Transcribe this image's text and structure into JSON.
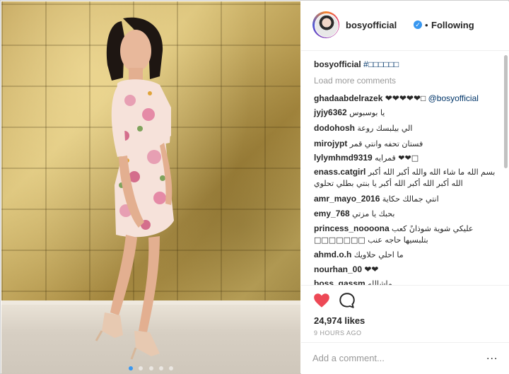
{
  "post": {
    "username": "bosyofficial",
    "verified_mark": "✓",
    "separator": "•",
    "follow_status": "Following",
    "caption_user": "bosyofficial",
    "caption_text": "#□□□□□□",
    "load_more": "Load more comments",
    "likes": "24,974 likes",
    "time": "9 HOURS AGO",
    "add_comment_placeholder": "Add a comment...",
    "more_icon": "...",
    "carousel_active_index": 0
  },
  "comments": [
    {
      "user": "ghadaabdelrazek",
      "text": "❤❤❤❤❤□",
      "mention": "@bosyofficial"
    },
    {
      "user": "jyjy6362",
      "text": "يا بوسبوس"
    },
    {
      "user": "dodohosh",
      "text": "الي بيلبسك روعة"
    },
    {
      "user": "mirojypt",
      "text": "فستان تحفه وانتي قمر"
    },
    {
      "user": "lylymhmd9319",
      "text": "قمرايه ❤❤□"
    },
    {
      "user": "enass.catgirl",
      "text": "بسم الله ما شاء الله والله أكبر الله أكبر",
      "text2": "الله أكبر الله أكبر الله أكبر يا بنتي بطلي تحلوي"
    },
    {
      "user": "amr_mayo_2016",
      "text": "انتي جمالك حكاية"
    },
    {
      "user": "emy_768",
      "text": "بحبك يا مزتي"
    },
    {
      "user": "princess_noooona",
      "text": "عليكي شوية شوذانً كعب",
      "text2": "□□□□□□□ بتلبسيها حاجه عنب"
    },
    {
      "user": "ahmd.o.h",
      "text": "ما احلي حلاويك"
    },
    {
      "user": "nourhan_00",
      "text": "❤❤"
    },
    {
      "user": "boss_gassm",
      "text": "ماشالله"
    }
  ],
  "colors": {
    "link": "#003569",
    "heart": "#ed4956",
    "verified": "#3897f0",
    "muted": "#999999"
  },
  "icons": [
    "heart-icon",
    "comment-icon",
    "verified-icon",
    "more-options-icon"
  ]
}
